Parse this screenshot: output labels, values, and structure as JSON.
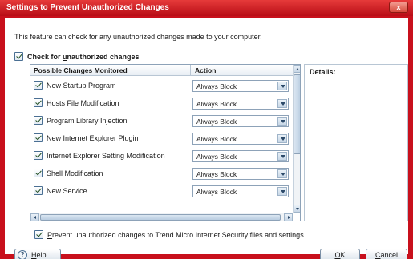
{
  "window": {
    "title": "Settings to Prevent Unauthorized Changes",
    "close_glyph": "x"
  },
  "intro_text": "This feature can check for any unauthorized changes made to your computer.",
  "master_check": {
    "label_pre": "Check for ",
    "label_underlined": "u",
    "label_post": "nauthorized changes",
    "checked": true
  },
  "table": {
    "headers": [
      "Possible Changes Monitored",
      "Action"
    ],
    "rows": [
      {
        "label": "New Startup Program",
        "action": "Always Block",
        "checked": true
      },
      {
        "label": "Hosts File Modification",
        "action": "Always Block",
        "checked": true
      },
      {
        "label": "Program Library Injection",
        "action": "Always Block",
        "checked": true
      },
      {
        "label": "New Internet Explorer Plugin",
        "action": "Always Block",
        "checked": true
      },
      {
        "label": "Internet Explorer Setting Modification",
        "action": "Always Block",
        "checked": true
      },
      {
        "label": "Shell Modification",
        "action": "Always Block",
        "checked": true
      },
      {
        "label": "New Service",
        "action": "Always Block",
        "checked": true
      }
    ]
  },
  "details": {
    "label": "Details:"
  },
  "protect_check": {
    "label_underlined": "P",
    "label_post": "revent unauthorized changes to Trend Micro Internet Security files and settings",
    "checked": true
  },
  "buttons": {
    "help_icon": "?",
    "help_underlined": "H",
    "help_post": "elp",
    "ok_underlined": "O",
    "ok_post": "K",
    "cancel_underlined": "C",
    "cancel_post": "ancel"
  },
  "colors": {
    "title_bar": "#c8101c",
    "accent_border": "#8da2b8"
  }
}
